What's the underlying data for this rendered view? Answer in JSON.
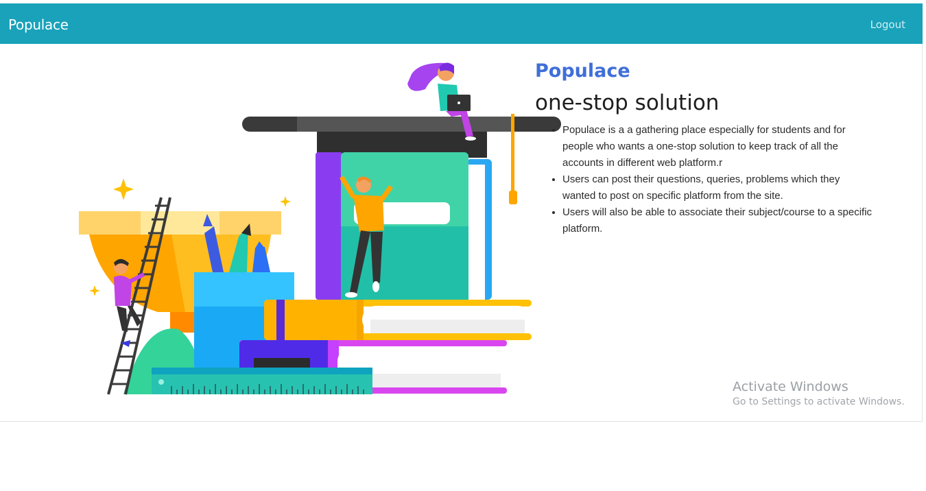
{
  "navbar": {
    "brand": "Populace",
    "logout_label": "Logout",
    "bg_color": "#19a2ba"
  },
  "hero": {
    "brand": "Populace",
    "title": "one-stop solution",
    "features": [
      "Populace is a a gathering place especially for students and for people who wants a one-stop solution to keep track of all the accounts in different web platform.r",
      "Users can post their questions, queries, problems which they wanted to post on specific platform from the site.",
      "Users will also be able to associate their subject/course to a specific platform."
    ],
    "brand_color": "#3f6fd8"
  },
  "illustration": {
    "name": "education-illustration"
  },
  "watermark": {
    "title": "Activate Windows",
    "subtitle": "Go to Settings to activate Windows."
  }
}
